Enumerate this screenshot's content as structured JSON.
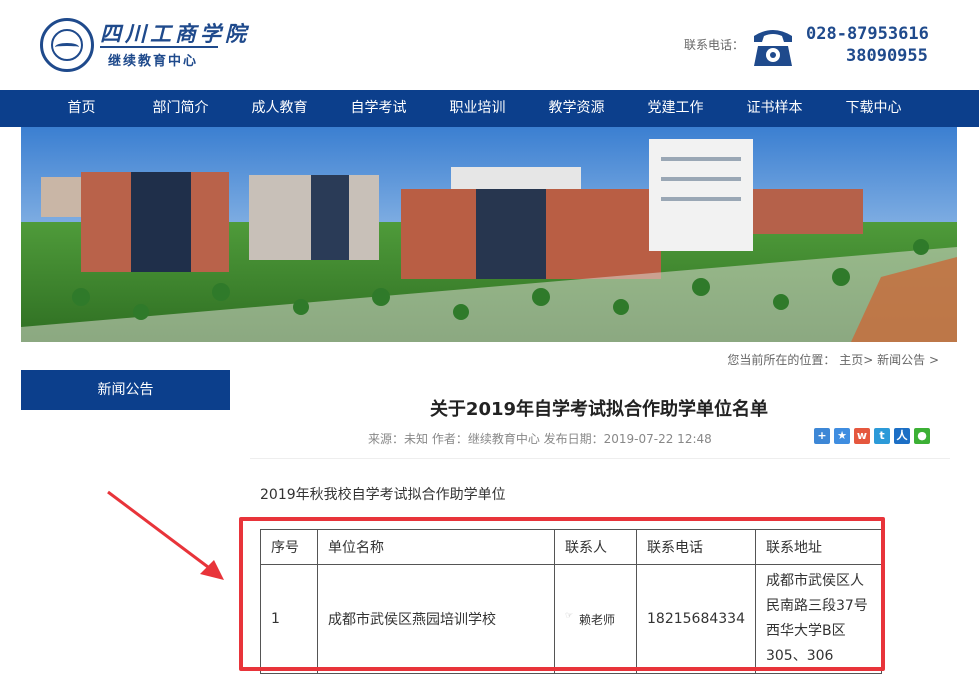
{
  "header": {
    "logo_name": "四川工商学院",
    "logo_sub": "继续教育中心",
    "contact_label": "联系电话：",
    "phone_1": "028-87953616",
    "phone_2": "38090955"
  },
  "nav": {
    "items": [
      "首页",
      "部门简介",
      "成人教育",
      "自学考试",
      "职业培训",
      "教学资源",
      "党建工作",
      "证书样本",
      "下载中心"
    ]
  },
  "breadcrumb": {
    "label": "您当前所在的位置：",
    "home": "主页",
    "current": "新闻公告",
    "sep": ">"
  },
  "sidebar": {
    "title": "新闻公告"
  },
  "article": {
    "title": "关于2019年自学考试拟合作助学单位名单",
    "meta": "来源：未知 作者：继续教育中心 发布日期：2019-07-22 12:48",
    "intro": "2019年秋我校自学考试拟合作助学单位",
    "share_icons": [
      "share-plus-icon",
      "qzone-icon",
      "weibo-icon",
      "tencent-weibo-icon",
      "renren-icon",
      "wechat-icon"
    ]
  },
  "table": {
    "headers": [
      "序号",
      "单位名称",
      "联系人",
      "联系电话",
      "联系地址"
    ],
    "rows": [
      {
        "no": "1",
        "name": "成都市武侯区燕园培训学校",
        "contact": "赖老师",
        "phone": "18215684334",
        "address_lines": [
          "成都市武侯区人",
          "民南路三段37号",
          "西华大学B区",
          "305、306"
        ]
      }
    ]
  },
  "colors": {
    "nav_bg": "#0c3f8c",
    "brand": "#1f4a8c",
    "highlight": "#e8343a"
  }
}
